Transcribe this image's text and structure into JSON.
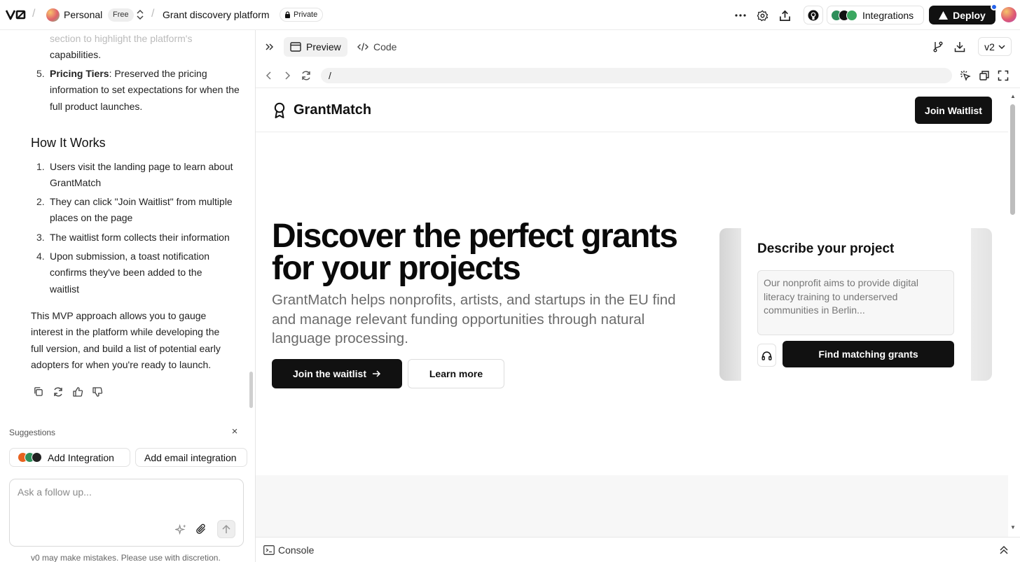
{
  "topbar": {
    "workspace": "Personal",
    "plan_badge": "Free",
    "separator": "/",
    "project": "Grant discovery platform",
    "visibility": "Private",
    "integrations_label": "Integrations",
    "deploy_label": "Deploy",
    "integration_colors": [
      "#2f8f5b",
      "#111111",
      "#3aa760"
    ]
  },
  "chat": {
    "prev_item_fragment_line1": "section to highlight the platform's",
    "prev_item_fragment_line2": "capabilities.",
    "pricing_item": {
      "number": "5.",
      "title": "Pricing Tiers",
      "text": ": Preserved the pricing information to set expectations for when the full product launches."
    },
    "how_it_works_heading": "How It Works",
    "steps": [
      {
        "number": "1.",
        "text": "Users visit the landing page to learn about GrantMatch"
      },
      {
        "number": "2.",
        "text": "They can click \"Join Waitlist\" from multiple places on the page"
      },
      {
        "number": "3.",
        "text": "The waitlist form collects their information"
      },
      {
        "number": "4.",
        "text": "Upon submission, a toast notification confirms they've been added to the waitlist"
      }
    ],
    "summary": "This MVP approach allows you to gauge interest in the platform while developing the full version, and build a list of potential early adopters for when you're ready to launch.",
    "suggestions_label": "Suggestions",
    "suggestions": [
      "Add Integration",
      "Add email integration"
    ],
    "input_placeholder": "Ask a follow up...",
    "disclaimer": "v0 may make mistakes. Please use with discretion."
  },
  "preview": {
    "tabs": [
      "Preview",
      "Code"
    ],
    "version": "v2",
    "url": "/",
    "console_label": "Console"
  },
  "site": {
    "brand": "GrantMatch",
    "nav_cta": "Join Waitlist",
    "hero_title": "Discover the perfect grants for your projects",
    "hero_subtitle": "GrantMatch helps nonprofits, artists, and startups in the EU find and manage relevant funding opportunities through natural language processing.",
    "primary_cta": "Join the waitlist",
    "secondary_cta": "Learn more",
    "card_title": "Describe your project",
    "card_placeholder": "Our nonprofit aims to provide digital literacy training to underserved communities in Berlin...",
    "card_cta": "Find matching grants"
  },
  "colors": {
    "accent_dark": "#111111",
    "notification_dot": "#2563eb"
  }
}
